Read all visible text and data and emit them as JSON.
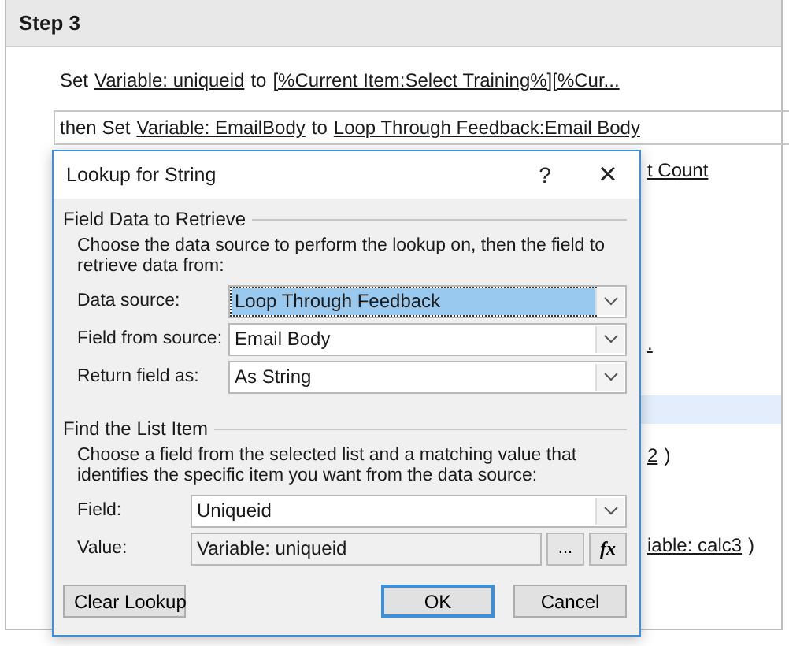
{
  "step": {
    "title": "Step 3"
  },
  "actions": [
    {
      "kind": "line",
      "selected": false,
      "hovered": false,
      "parts": [
        {
          "text": "Set",
          "link": false
        },
        {
          "text": "Variable: uniqueid",
          "link": true
        },
        {
          "text": "to",
          "link": false
        },
        {
          "text": "[%Current Item:Select Training%][%Cur...",
          "link": true
        }
      ]
    },
    {
      "kind": "line",
      "selected": true,
      "hovered": false,
      "parts": [
        {
          "text": "then Set",
          "link": false
        },
        {
          "text": "Variable: EmailBody",
          "link": true
        },
        {
          "text": "to",
          "link": false
        },
        {
          "text": "Loop Through Feedback:Email Body",
          "link": true
        }
      ]
    },
    {
      "kind": "fragment",
      "selected": false,
      "hovered": false,
      "parts": [
        {
          "text": "t Count",
          "link": true
        }
      ]
    },
    {
      "kind": "fragment",
      "selected": false,
      "hovered": false,
      "parts": [
        {
          "text": ".",
          "link": true
        }
      ]
    },
    {
      "kind": "fragment",
      "selected": false,
      "hovered": true
    },
    {
      "kind": "fragment",
      "selected": false,
      "hovered": false,
      "parts": [
        {
          "text": "2",
          "link": true
        },
        {
          "text": ")",
          "link": false
        }
      ]
    },
    {
      "kind": "fragment",
      "selected": false,
      "hovered": false,
      "parts": [
        {
          "text": "iable: calc3",
          "link": true
        },
        {
          "text": ")",
          "link": false
        }
      ]
    }
  ],
  "dialog": {
    "title": "Lookup for String",
    "help": "?",
    "close": "×",
    "groups": [
      {
        "title": "Field Data to Retrieve",
        "description": "Choose the data source to perform the lookup on, then the field to retrieve data from:",
        "fields": [
          {
            "kind": "dropdown",
            "label": "Data source:",
            "value": "Loop Through Feedback",
            "focused": true
          },
          {
            "kind": "dropdown",
            "label": "Field from source:",
            "value": "Email Body",
            "focused": false
          },
          {
            "kind": "dropdown",
            "label": "Return field as:",
            "value": "As String",
            "focused": false
          }
        ]
      },
      {
        "title": "Find the List Item",
        "description": "Choose a field from the selected list and a matching value that identifies the specific item you want from the data source:",
        "fields": [
          {
            "kind": "dropdown",
            "label": "Field:",
            "value": "Uniqueid",
            "focused": false
          },
          {
            "kind": "value",
            "label": "Value:",
            "value": "Variable: uniqueid",
            "focused": false,
            "browse": "...",
            "formula": "fx"
          }
        ]
      }
    ],
    "buttons": [
      {
        "label": "Clear Lookup",
        "default": false
      },
      {
        "label": "OK",
        "default": true
      },
      {
        "label": "Cancel",
        "default": false
      }
    ]
  }
}
